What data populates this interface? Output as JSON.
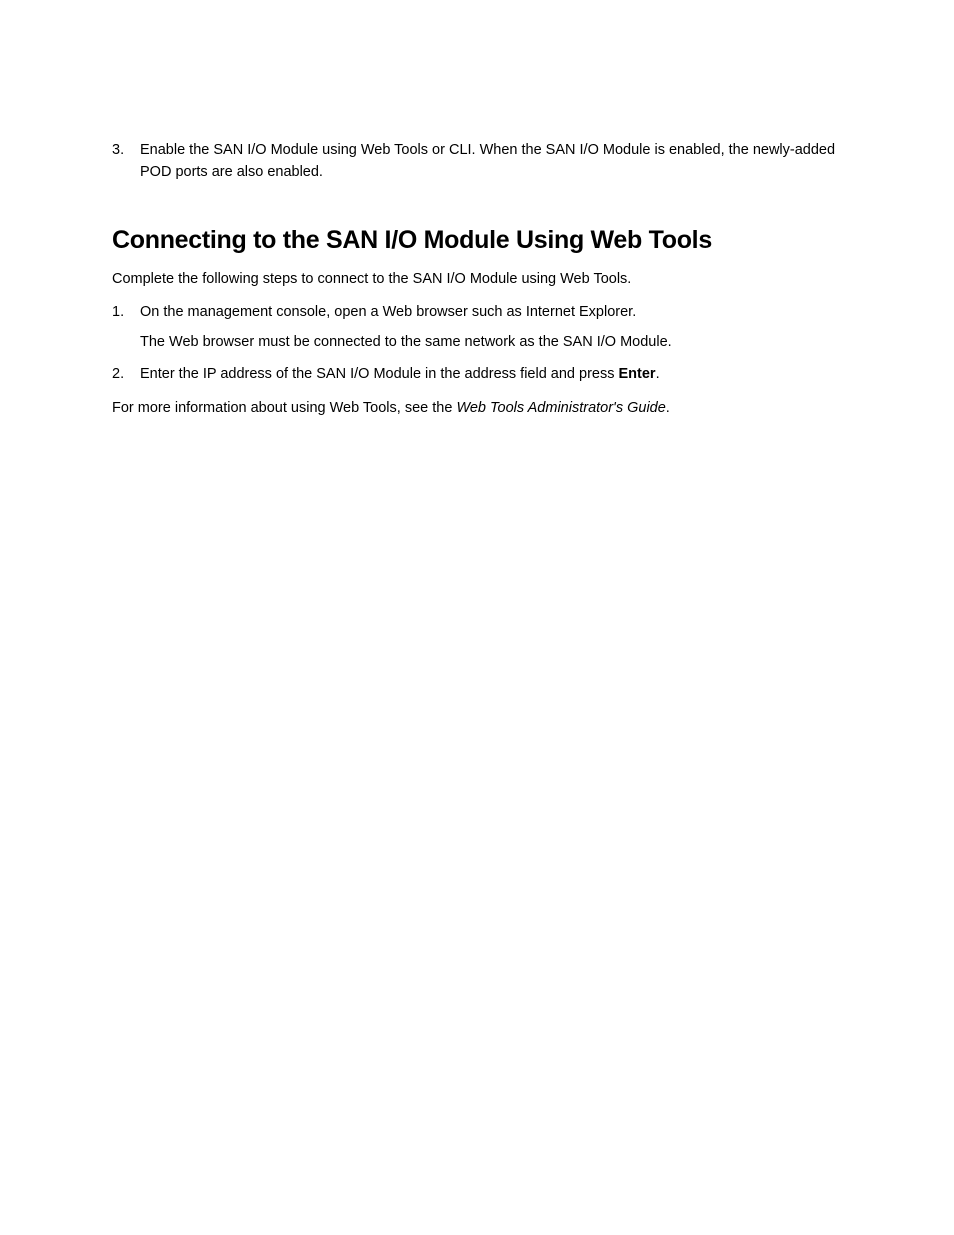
{
  "top_step": {
    "number": "3.",
    "text": "Enable the SAN I/O Module using Web Tools or CLI. When the SAN I/O Module is enabled, the newly-added POD ports are also enabled."
  },
  "heading": "Connecting to the SAN I/O Module Using Web Tools",
  "intro": "Complete the following steps to connect to the SAN I/O Module using Web Tools.",
  "steps": [
    {
      "number": "1.",
      "text": "On the management console, open a Web browser such as Internet Explorer.",
      "subtext": "The Web browser must be connected to the same network as the SAN I/O Module."
    },
    {
      "number": "2.",
      "text_pre": "Enter the IP address of the SAN I/O Module in the address field and press ",
      "text_bold": "Enter",
      "text_post": "."
    }
  ],
  "footer": {
    "pre": "For more information about using Web Tools, see the ",
    "italic": "Web Tools Administrator's Guide",
    "post": "."
  }
}
